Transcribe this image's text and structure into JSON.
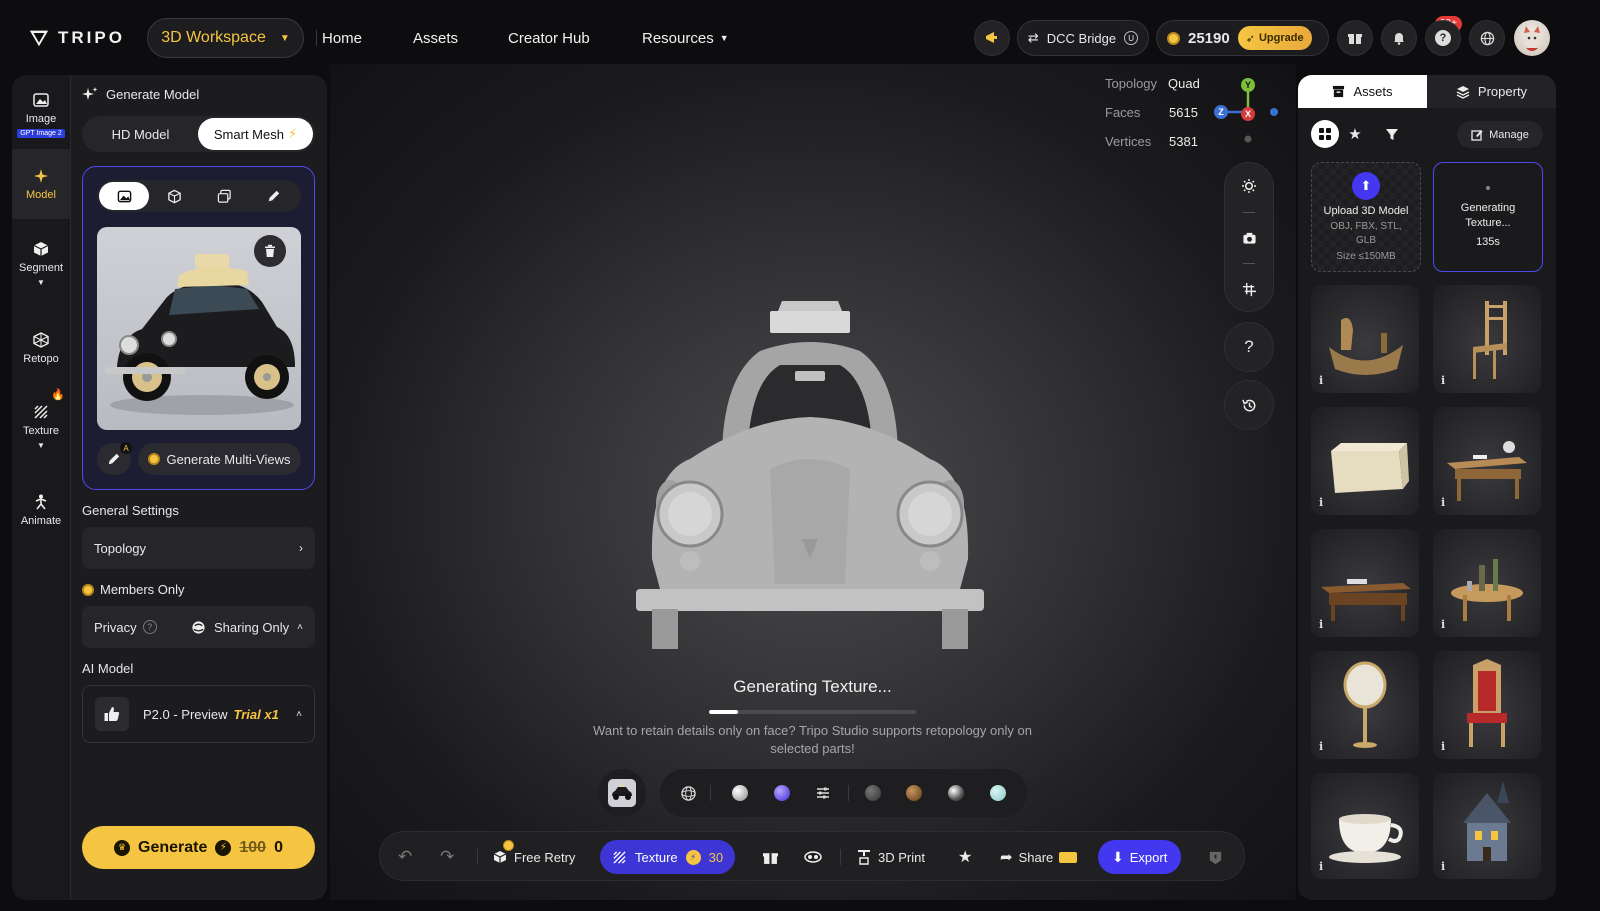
{
  "topbar": {
    "logo_text": "TRIPO",
    "workspace_label": "3D Workspace",
    "nav": [
      "Home",
      "Assets",
      "Creator Hub",
      "Resources"
    ],
    "dcc_bridge_label": "DCC Bridge",
    "credits": "25190",
    "upgrade_label": "Upgrade",
    "notification_badge": "99+"
  },
  "rail": {
    "items": [
      {
        "label": "Image",
        "tag": "GPT Image 2"
      },
      {
        "label": "Model"
      },
      {
        "label": "Segment"
      },
      {
        "label": "Retopo"
      },
      {
        "label": "Texture"
      },
      {
        "label": "Animate"
      }
    ]
  },
  "panel": {
    "title": "Generate Model",
    "mode_tabs": [
      "HD Model",
      "Smart Mesh"
    ],
    "multi_view_label": "Generate Multi-Views",
    "general_settings_label": "General Settings",
    "topology_label": "Topology",
    "members_only_label": "Members Only",
    "privacy_label": "Privacy",
    "privacy_value": "Sharing Only",
    "ai_model_label": "AI Model",
    "ai_model_value": "P2.0 - Preview",
    "ai_model_trial": "Trial x1",
    "generate_label": "Generate",
    "generate_cost_old": "100",
    "generate_cost_new": "0"
  },
  "viewport": {
    "stats": [
      {
        "label": "Topology",
        "value": "Quad"
      },
      {
        "label": "Faces",
        "value": "5615"
      },
      {
        "label": "Vertices",
        "value": "5381"
      }
    ],
    "axes": {
      "y": "Y",
      "z": "Z",
      "x": "X"
    },
    "status_text": "Generating Texture...",
    "progress": 0.14,
    "hint": "Want to retain details only on face? Tripo Studio supports retopology only on selected parts!",
    "help_glyph": "?"
  },
  "bottombar": {
    "free_retry_label": "Free Retry",
    "texture_label": "Texture",
    "texture_cost": "30",
    "print_label": "3D Print",
    "share_label": "Share",
    "export_label": "Export"
  },
  "rpanel": {
    "tabs": [
      "Assets",
      "Property"
    ],
    "manage_label": "Manage",
    "upload": {
      "title": "Upload 3D Model",
      "formats": "OBJ, FBX, STL, GLB",
      "size": "Size ≤150MB"
    },
    "generating": {
      "title": "Generating Texture...",
      "time": "135s"
    },
    "assets": [
      "boat",
      "chair",
      "crate",
      "desk",
      "writing-desk",
      "table",
      "mirror",
      "throne",
      "teacup",
      "house"
    ],
    "info_glyph": "i"
  },
  "colors": {
    "accent": "#4338f0",
    "gold": "#f5c542",
    "panel": "#1c1c1f"
  }
}
